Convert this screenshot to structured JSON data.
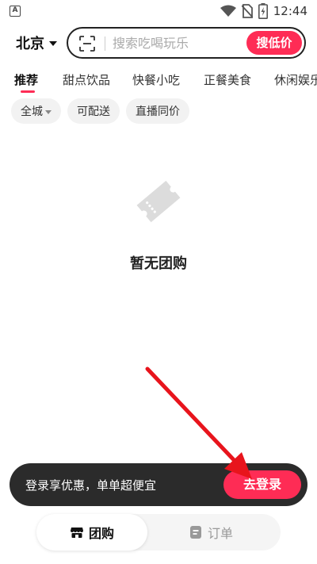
{
  "status_bar": {
    "app_icon_letter": "A",
    "time": "12:44",
    "icons": [
      "wifi-icon",
      "no-sim-icon",
      "battery-charging-icon"
    ]
  },
  "header": {
    "city": "北京",
    "search_placeholder": "搜索吃喝玩乐",
    "search_button": "搜低价"
  },
  "categories": [
    {
      "label": "推荐",
      "active": true
    },
    {
      "label": "甜点饮品",
      "active": false
    },
    {
      "label": "快餐小吃",
      "active": false
    },
    {
      "label": "正餐美食",
      "active": false
    },
    {
      "label": "休闲娱乐",
      "active": false
    }
  ],
  "filters": [
    {
      "label": "全城",
      "dropdown": true
    },
    {
      "label": "可配送",
      "dropdown": false
    },
    {
      "label": "直播同价",
      "dropdown": false
    }
  ],
  "empty_state": {
    "icon": "ticket-icon",
    "text": "暂无团购"
  },
  "login_banner": {
    "text": "登录享优惠，单单超便宜",
    "button": "去登录"
  },
  "bottom_tabs": [
    {
      "label": "团购",
      "icon": "store-icon",
      "active": true
    },
    {
      "label": "订单",
      "icon": "order-icon",
      "active": false
    }
  ],
  "colors": {
    "accent": "#fe2c55",
    "banner_bg": "#2b2b2b",
    "annotation_arrow": "#e8141c"
  }
}
